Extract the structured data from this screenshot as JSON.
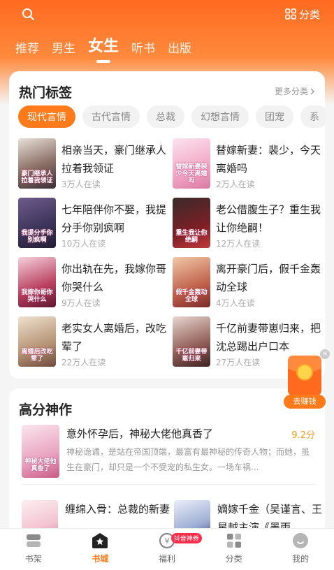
{
  "header": {
    "category_label": "分类",
    "tabs": [
      "推荐",
      "男生",
      "女生",
      "听书",
      "出版"
    ]
  },
  "hot_tags": {
    "title": "热门标签",
    "more_label": "更多分类",
    "chips": [
      "现代言情",
      "古代言情",
      "总裁",
      "幻想言情",
      "团宠",
      "系"
    ],
    "books": [
      {
        "title": "相亲当天，豪门继承人拉着我领证",
        "readers": "3万人在读",
        "cover_text": "豪门继承人拉着我领证"
      },
      {
        "title": "替嫁新妻：裴少，今天离婚吗",
        "readers": "2万人在读",
        "cover_text": "替嫁新妻裴少今天离婚吗"
      },
      {
        "title": "七年陪伴你不娶，我提分手你别疯啊",
        "readers": "10万人在读",
        "cover_text": "我提分手你别疯啊"
      },
      {
        "title": "老公借腹生子？重生我让你绝嗣！",
        "readers": "12万人在读",
        "cover_text": "重生我让你绝嗣"
      },
      {
        "title": "你出轨在先，我嫁你哥你哭什么",
        "readers": "9万人在读",
        "cover_text": "我嫁你哥你哭什么"
      },
      {
        "title": "离开豪门后，假千金轰动全球",
        "readers": "4万人在读",
        "cover_text": "假千金轰动全球"
      },
      {
        "title": "老实女人离婚后，改吃荤了",
        "readers": "22万人在读",
        "cover_text": "离婚后改吃荤了"
      },
      {
        "title": "千亿前妻带崽归来，把沈总踢出户口本",
        "readers": "27万人在读",
        "cover_text": "千亿前妻带崽归来"
      }
    ]
  },
  "top_rated": {
    "title": "高分神作",
    "featured": {
      "title": "意外怀孕后，神秘大佬他真香了",
      "score": "9.2分",
      "desc": "神秘诡谲，是站在帝国顶端，最富有最神秘的传奇人物；而她，虽生在豪门，却只是一个不受宠的私生女。一场车祸...",
      "cover_text": "神秘大佬他真香了"
    },
    "more_books": [
      {
        "title": "缠绵入骨：总裁的新妻"
      },
      {
        "title": "嫡嫁千金（吴谨言、王星越主演《墨雨"
      }
    ]
  },
  "float_widget": {
    "label": "去赚钱",
    "close": "×"
  },
  "bottom_nav": {
    "items": [
      "书架",
      "书城",
      "福利",
      "分类",
      "我的"
    ],
    "badge": "抖音神券"
  },
  "colors": {
    "accent": "#ff7a1a",
    "header": "#ff6a1f",
    "score": "#ff9a1a",
    "badge": "#ff2d4a"
  }
}
